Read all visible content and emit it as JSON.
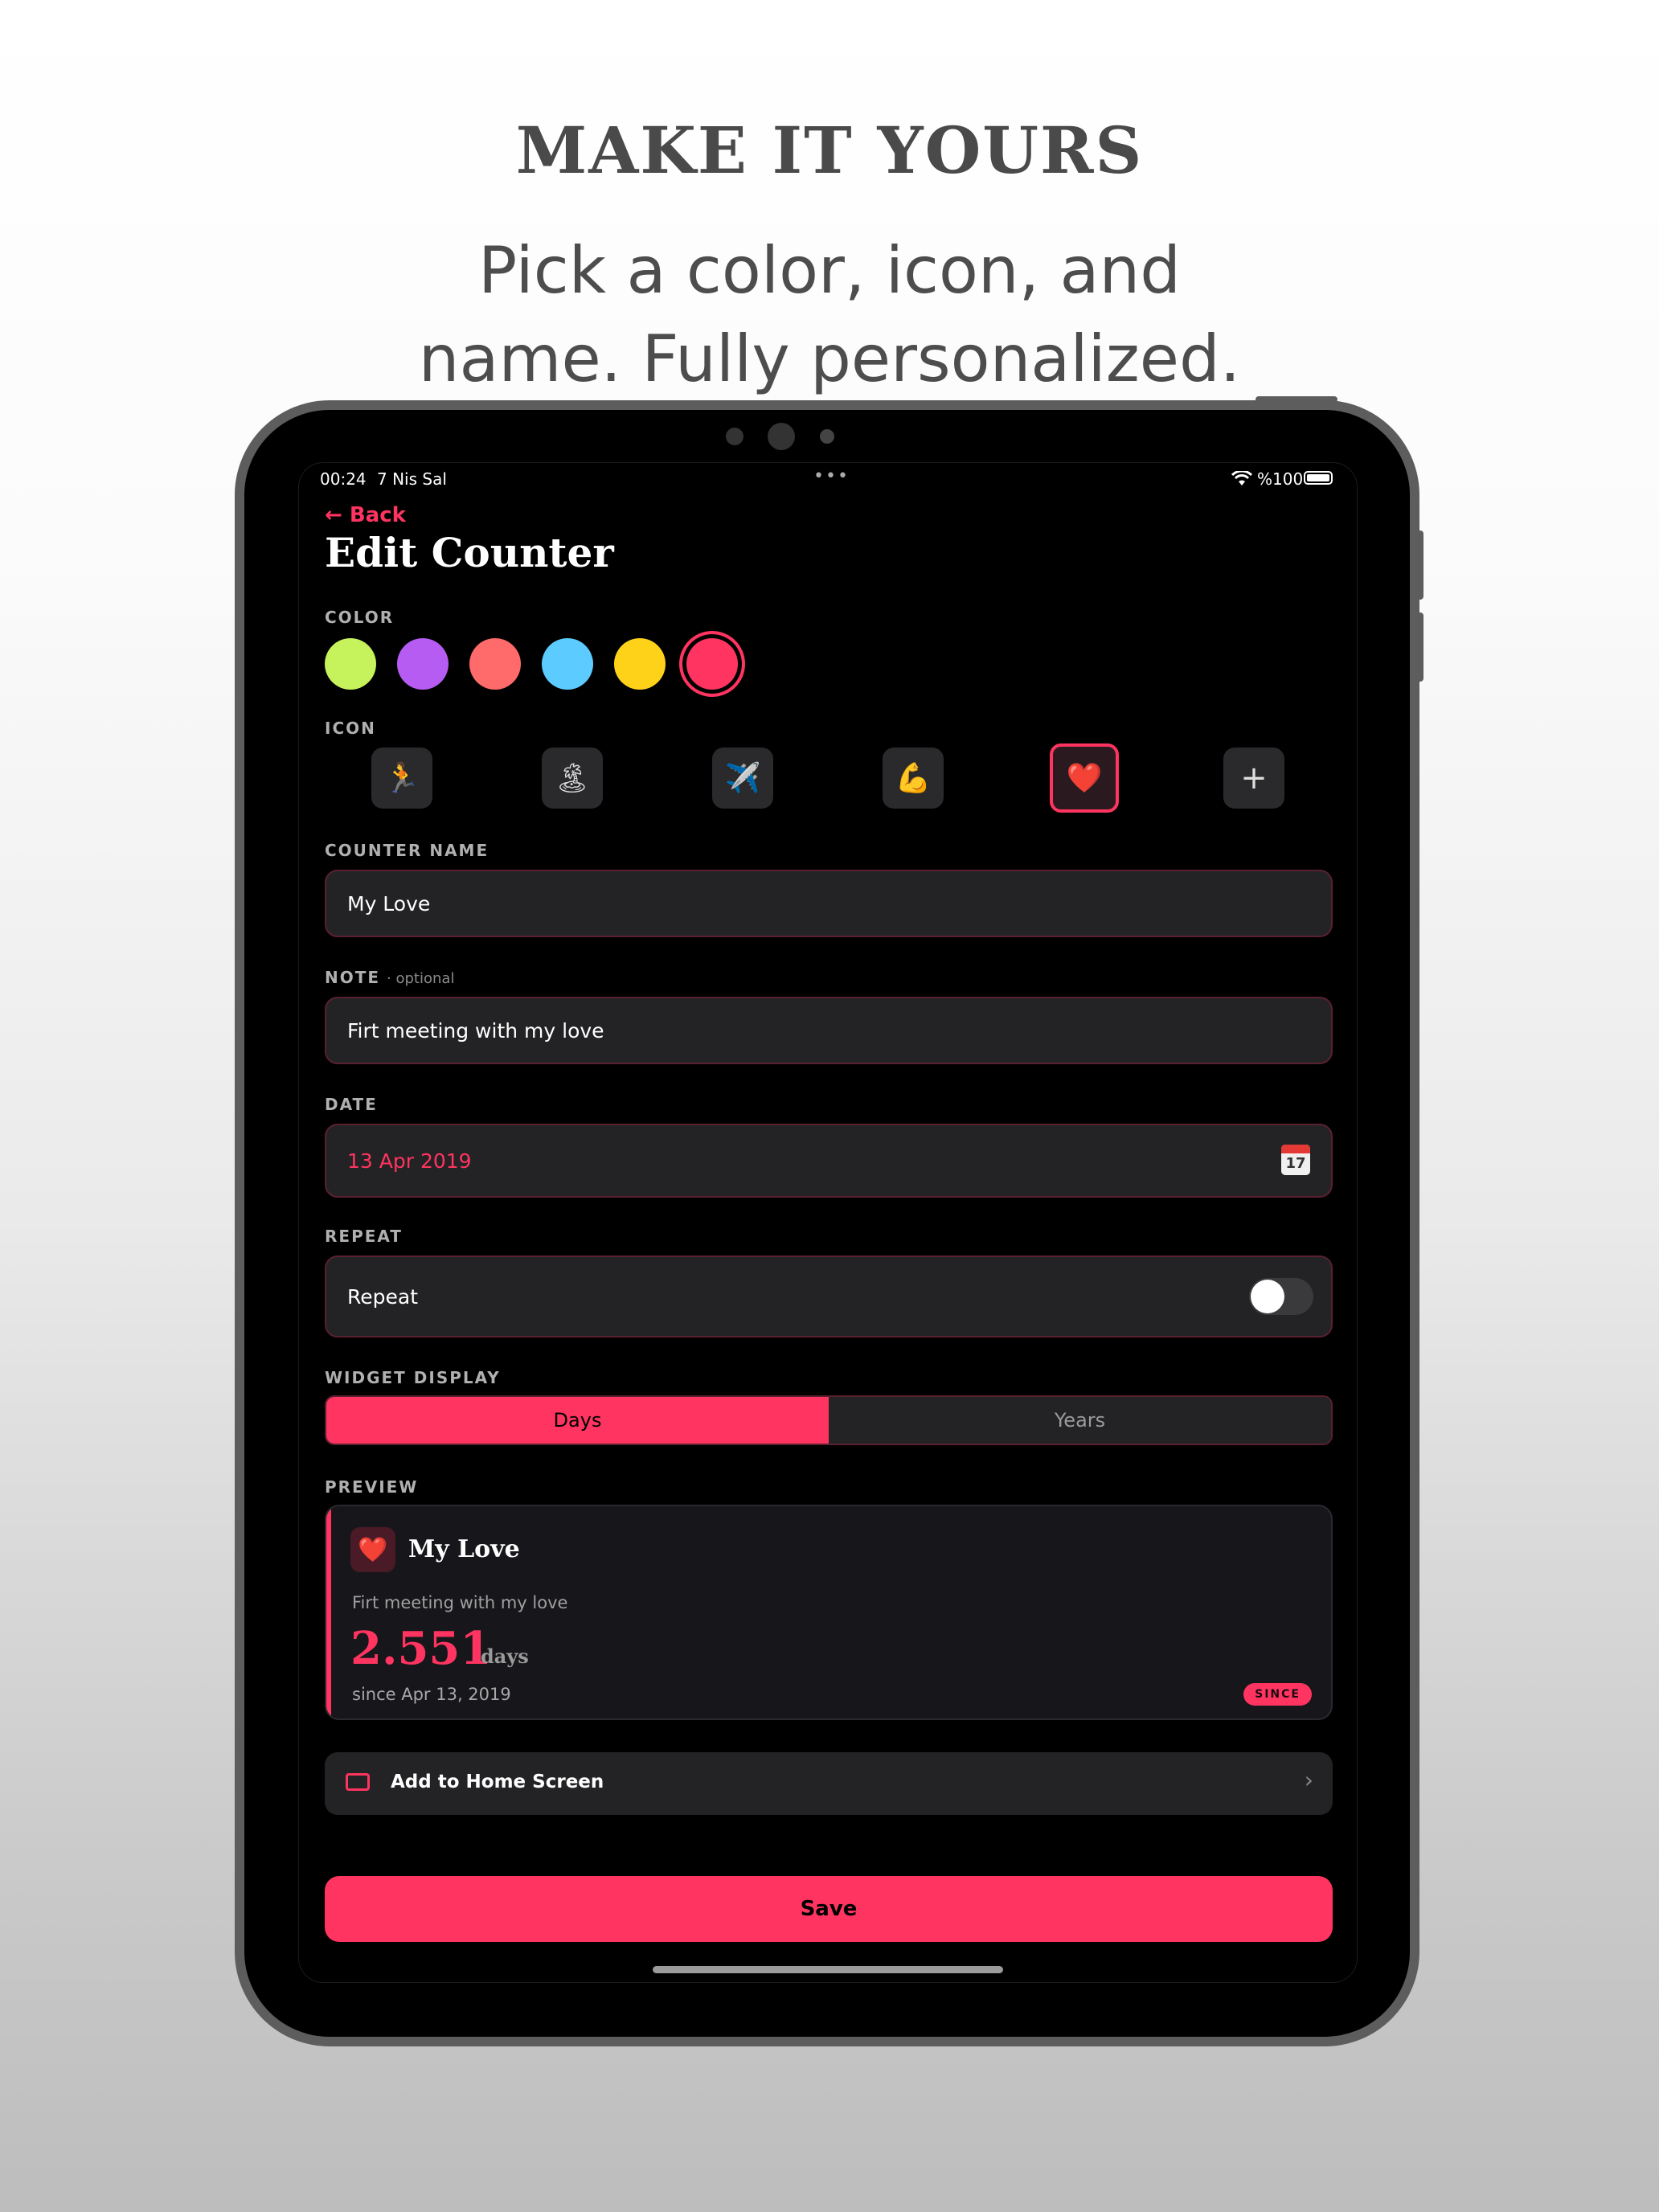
{
  "marketing": {
    "headline": "MAKE IT YOURS",
    "subline_1": "Pick a color, icon, and",
    "subline_2": "name. Fully personalized."
  },
  "status_bar": {
    "time": "00:24",
    "date": "7 Nis Sal",
    "battery": "%100",
    "icons": [
      "wifi-icon",
      "battery-icon"
    ]
  },
  "nav": {
    "back_label": "Back",
    "title": "Edit Counter"
  },
  "colors": {
    "label": "COLOR",
    "swatches": [
      "#c6f25c",
      "#b65cf2",
      "#ff6a6a",
      "#5ccbff",
      "#ffd21a",
      "#ff3460"
    ],
    "selected": "#ff3460"
  },
  "icons": {
    "label": "ICON",
    "items": [
      "🏃",
      "🏝",
      "✈️",
      "💪",
      "❤️",
      "+"
    ],
    "names": [
      "runner-icon",
      "island-icon",
      "airplane-icon",
      "muscle-icon",
      "heart-icon",
      "add-icon"
    ],
    "selected": "heart-icon"
  },
  "counter_name": {
    "label": "COUNTER NAME",
    "value": "My Love"
  },
  "note": {
    "label": "NOTE",
    "optional": "· optional",
    "value": "Firt meeting with my love"
  },
  "date": {
    "label": "DATE",
    "value": "13 Apr 2019",
    "calendar_day": "17"
  },
  "repeat": {
    "label": "REPEAT",
    "row_label": "Repeat",
    "enabled": false
  },
  "widget_display": {
    "label": "WIDGET DISPLAY",
    "options": [
      "Days",
      "Years"
    ],
    "selected": "Days"
  },
  "preview": {
    "label": "PREVIEW",
    "icon": "❤️",
    "name": "My Love",
    "note": "Firt meeting with my love",
    "count": "2.551",
    "unit": "days",
    "since": "since Apr 13, 2019",
    "badge": "SINCE"
  },
  "home_screen": {
    "label": "Add to Home Screen",
    "chevron": "›"
  },
  "save": {
    "label": "Save"
  },
  "accent": "#ff3460"
}
